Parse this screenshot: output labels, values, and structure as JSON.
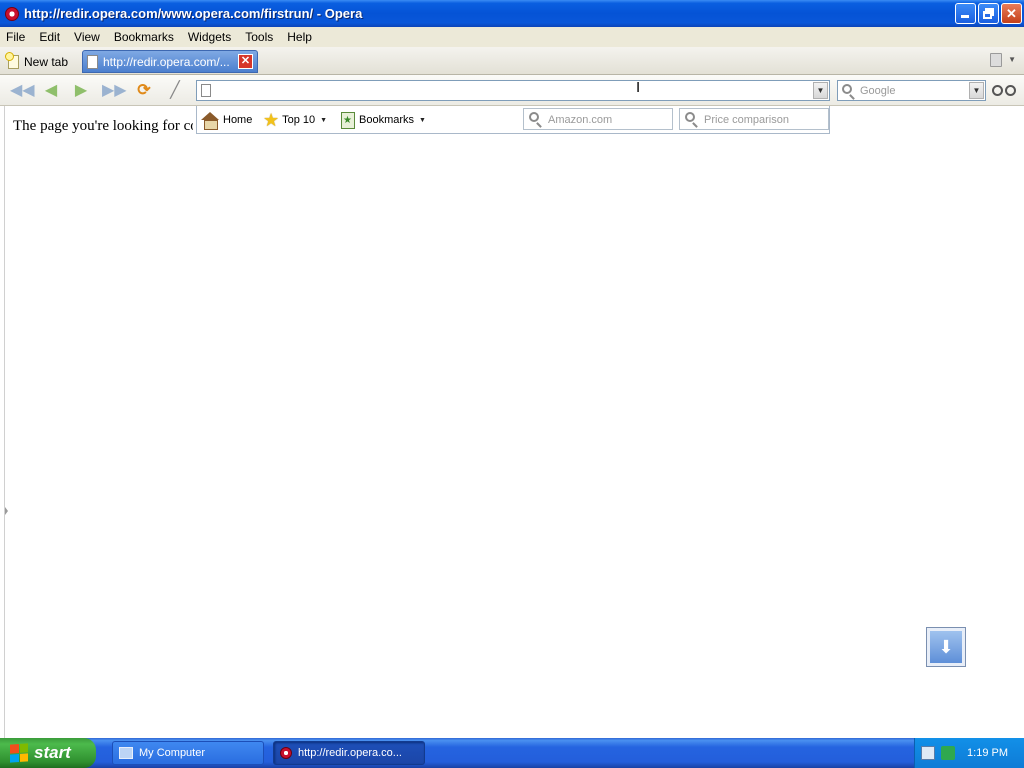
{
  "window": {
    "title": "http://redir.opera.com/www.opera.com/firstrun/ - Opera"
  },
  "menu": [
    "File",
    "Edit",
    "View",
    "Bookmarks",
    "Widgets",
    "Tools",
    "Help"
  ],
  "tabs": {
    "new_tab_label": "New tab",
    "active_tab_label": "http://redir.opera.com/...",
    "close_glyph": "✕"
  },
  "toolbar": {
    "address_value": "",
    "search_placeholder": "Google"
  },
  "speed_dial": {
    "home_label": "Home",
    "top10_label": "Top 10",
    "bookmarks_label": "Bookmarks",
    "amazon_placeholder": "Amazon.com",
    "price_placeholder": "Price comparison"
  },
  "page": {
    "text": "The page you're looking for co"
  },
  "taskbar": {
    "start_label": "start",
    "tasks": [
      {
        "label": "My Computer"
      },
      {
        "label": "http://redir.opera.co..."
      }
    ],
    "clock": "1:19 PM"
  }
}
